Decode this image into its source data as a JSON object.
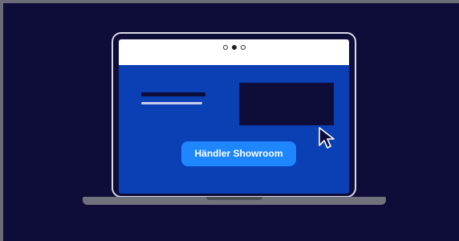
{
  "illustration": {
    "cta_label": "Händler Showroom",
    "icons": {
      "carousel_dots": "carousel-dots-icon",
      "cursor": "mouse-cursor-icon"
    },
    "colors": {
      "background": "#0e0c38",
      "screen_content": "#0b3fb4",
      "button": "#1e86ff",
      "browser_bar": "#ffffff",
      "laptop_base": "#6f727c"
    },
    "active_dot_index": 1
  }
}
